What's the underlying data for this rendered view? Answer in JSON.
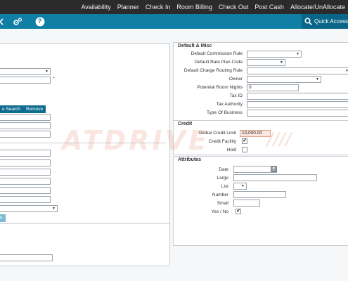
{
  "topnav": {
    "items": [
      "Availability",
      "Planner",
      "Check In",
      "Room Billing",
      "Check Out",
      "Post Cash",
      "Allocate/UnAllocate"
    ]
  },
  "toolbar": {
    "icons": [
      "back-arrow-icon",
      "gear-icon",
      "help-icon"
    ],
    "help_glyph": "?",
    "quick_access_label": "Quick Access"
  },
  "left": {
    "required_marker": "*",
    "search_button": "e Search",
    "remove_button": "Remove",
    "partial_button": "h"
  },
  "default_misc": {
    "title": "Default & Misc",
    "labels": [
      "Default Commission Rule",
      "Default Rate Plan Code",
      "Default Charge Routing Rule",
      "Owner",
      "Potential Room Nights",
      "Tax ID",
      "Tax Authority",
      "Type Of Business"
    ],
    "potential_room_nights_value": "0"
  },
  "credit": {
    "title": "Credit",
    "global_credit_limit_label": "Global Credit Limit",
    "global_credit_limit_value": "10,000.00",
    "credit_facility_label": "Credit Facility",
    "credit_facility_checked": true,
    "hold_label": "Hold",
    "hold_checked": false
  },
  "attributes": {
    "title": "Attributes",
    "labels": [
      "Date",
      "Large",
      "List",
      "Number",
      "Small",
      "Yes / No"
    ],
    "yes_no_checked": true
  },
  "watermark": {
    "text": "ATDRIVE",
    "slashes": "////",
    "color": "#e68c78"
  },
  "colors": {
    "nav_bg": "#2b2b2b",
    "toolbar_bg": "#0f7fa6",
    "button_bg": "#0f6c91",
    "required": "#e03030"
  }
}
